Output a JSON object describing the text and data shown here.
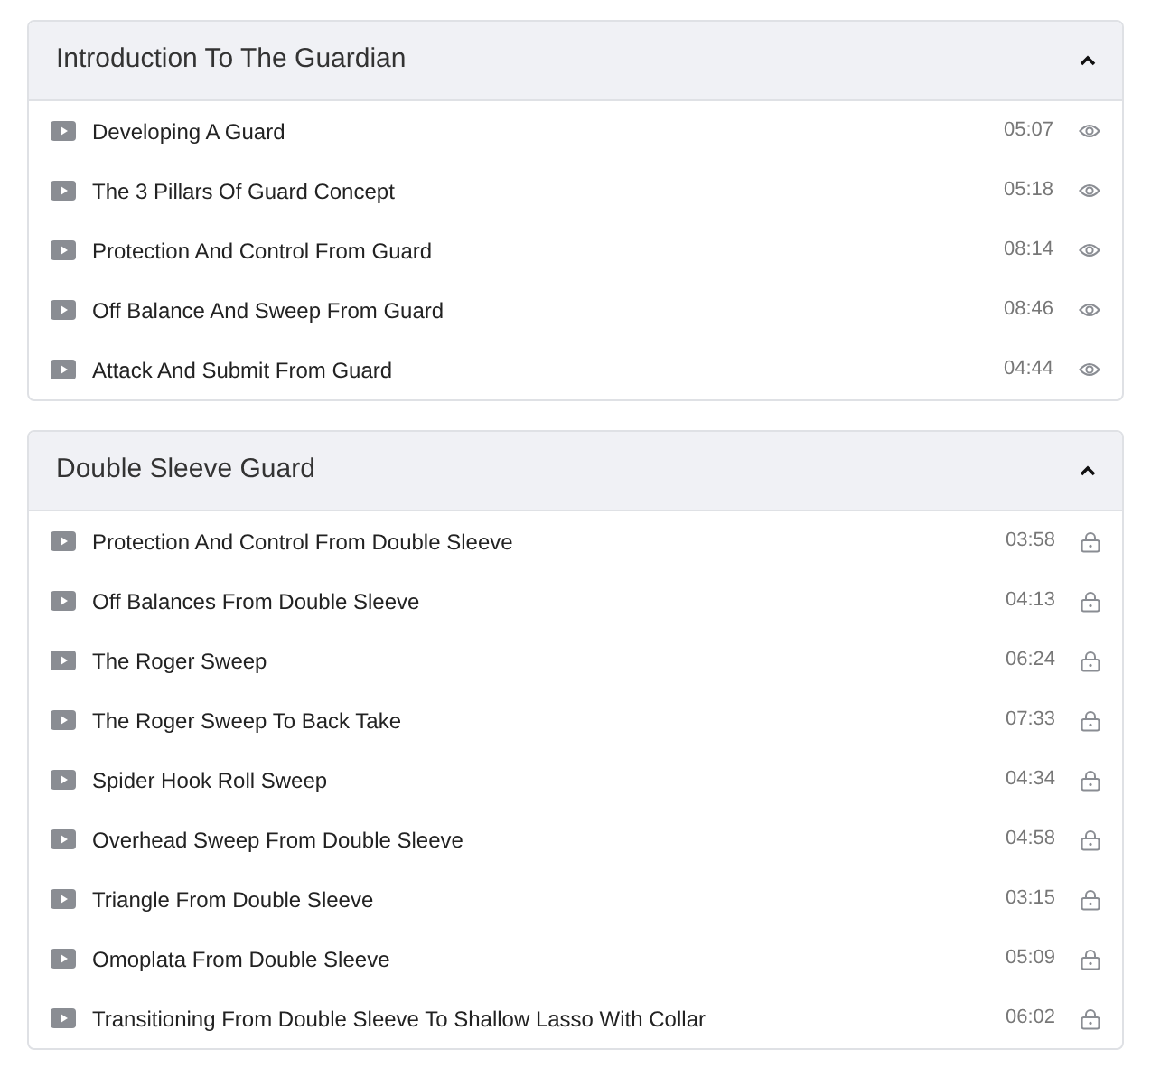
{
  "sections": [
    {
      "title": "Introduction To The Guardian",
      "expanded": true,
      "lessons": [
        {
          "title": "Developing A Guard",
          "duration": "05:07",
          "kind": "preview"
        },
        {
          "title": "The 3 Pillars Of Guard Concept",
          "duration": "05:18",
          "kind": "preview"
        },
        {
          "title": "Protection And Control From Guard",
          "duration": "08:14",
          "kind": "preview"
        },
        {
          "title": "Off Balance And Sweep From Guard",
          "duration": "08:46",
          "kind": "preview"
        },
        {
          "title": "Attack And Submit From Guard",
          "duration": "04:44",
          "kind": "preview"
        }
      ]
    },
    {
      "title": "Double Sleeve Guard",
      "expanded": true,
      "lessons": [
        {
          "title": "Protection And Control From Double Sleeve",
          "duration": "03:58",
          "kind": "locked"
        },
        {
          "title": "Off Balances From Double Sleeve",
          "duration": "04:13",
          "kind": "locked"
        },
        {
          "title": "The Roger Sweep",
          "duration": "06:24",
          "kind": "locked"
        },
        {
          "title": "The Roger Sweep To Back Take",
          "duration": "07:33",
          "kind": "locked"
        },
        {
          "title": "Spider Hook Roll Sweep",
          "duration": "04:34",
          "kind": "locked"
        },
        {
          "title": "Overhead Sweep From Double Sleeve",
          "duration": "04:58",
          "kind": "locked"
        },
        {
          "title": "Triangle From Double Sleeve",
          "duration": "03:15",
          "kind": "locked"
        },
        {
          "title": "Omoplata From Double Sleeve",
          "duration": "05:09",
          "kind": "locked"
        },
        {
          "title": "Transitioning From Double Sleeve To Shallow Lasso With Collar",
          "duration": "06:02",
          "kind": "locked"
        }
      ]
    }
  ]
}
